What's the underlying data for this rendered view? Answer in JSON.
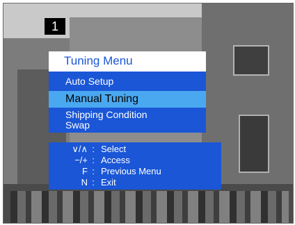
{
  "channel": {
    "number": "1"
  },
  "menu": {
    "title": "Tuning Menu",
    "items": [
      {
        "label": "Auto Setup",
        "selected": false
      },
      {
        "label": "Manual Tuning",
        "selected": true
      },
      {
        "label": "Shipping Condition",
        "selected": false
      },
      {
        "label": "Swap",
        "selected": false
      }
    ]
  },
  "help": {
    "rows": [
      {
        "key": "∨/∧",
        "colon": ":",
        "action": "Select"
      },
      {
        "key": "−/+",
        "colon": ":",
        "action": "Access"
      },
      {
        "key": "F",
        "colon": ":",
        "action": "Previous Menu"
      },
      {
        "key": "N",
        "colon": ":",
        "action": "Exit"
      }
    ]
  },
  "colors": {
    "menu_blue": "#1a56d6",
    "selected_cyan": "#4aa8f0",
    "title_bg": "#ffffff"
  }
}
